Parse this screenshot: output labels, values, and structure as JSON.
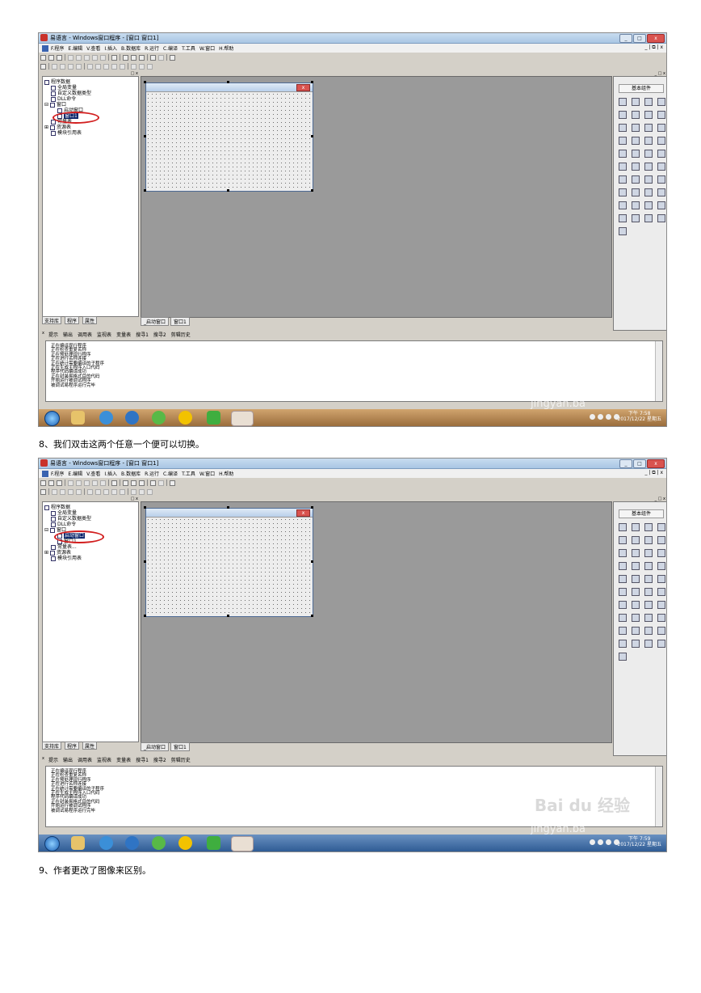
{
  "captions": [
    "8、我们双击这两个任意一个便可以切换。",
    "9、作者更改了图像来区别。"
  ],
  "ide": {
    "window_title": "易语言 - Windows窗口程序 - [窗口 窗口1]",
    "menus": [
      "F.程序",
      "E.编辑",
      "V.查看",
      "I.插入",
      "B.数据库",
      "R.运行",
      "C.编译",
      "T.工具",
      "W.窗口",
      "H.帮助"
    ],
    "left_panel": {
      "tree": [
        "程序数据",
        "全局变量",
        "自定义数据类型",
        "DLL命令",
        "窗口",
        "启动窗口",
        "窗口1",
        "常量表...",
        "资源表",
        "模块引用表"
      ],
      "tabs": [
        "支持库",
        "程序",
        "属性"
      ]
    },
    "workspace_tabs": [
      "_启动窗口",
      "窗口1"
    ],
    "right_panel": {
      "title": "基本组件"
    },
    "bottom_tabs": [
      "提示",
      "输出",
      "调用表",
      "监视表",
      "变量表",
      "搜寻1",
      "搜寻2",
      "剪辑历史"
    ],
    "output_lines": [
      "正在编译现行程序",
      "正在检查重复名称",
      "正在预处理现行程序",
      "正在进行名称连接",
      "正在统计需要编译的子程序",
      "正在生成主程序入口代码",
      "程序代码编译成功",
      "正在封装易格式目的代码",
      "开始运行被调试程序",
      "被调试易程序运行完毕"
    ]
  },
  "shots": [
    {
      "time": "下午 7:58",
      "date": "2017/12/22 星期五",
      "watermark": "jingyan.ba"
    },
    {
      "time": "下午 7:59",
      "date": "2017/12/22 星期五",
      "watermark": "jingyan.ba",
      "logo": "Bai du 经验"
    }
  ]
}
